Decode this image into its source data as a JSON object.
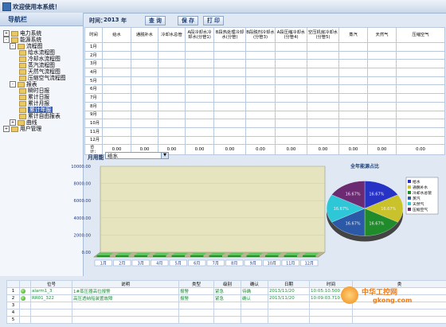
{
  "window": {
    "title": "欢迎使用本系统！"
  },
  "nav": {
    "header": "导航栏",
    "items": [
      {
        "label": "电力系统"
      },
      {
        "label": "能源系统"
      },
      {
        "label": "流程图"
      },
      {
        "label": "给水流程图"
      },
      {
        "label": "冷却水流程图"
      },
      {
        "label": "蒸汽流程图"
      },
      {
        "label": "天然气流程图"
      },
      {
        "label": "压缩空气流程图"
      },
      {
        "label": "报表"
      },
      {
        "label": "瞬时日报"
      },
      {
        "label": "累计日报"
      },
      {
        "label": "累计月报"
      },
      {
        "label": "累计年报"
      },
      {
        "label": "累计自由报表"
      },
      {
        "label": "曲线"
      },
      {
        "label": "用户管理"
      }
    ]
  },
  "toolbar": {
    "time_label": "时间：",
    "year": "2013",
    "year_unit": "年",
    "query": "查 询",
    "save": "保 存",
    "print": "打 印"
  },
  "table": {
    "headers": [
      "时间",
      "给水",
      "通脱补水",
      "冷却水总管",
      "A段冷却水冷却水(分管1)",
      "B段热处理冷却水(分管)",
      "B段脱剂冷却水(分管3)",
      "A段压缩冷却水(分管4)",
      "空压机房冷却水(分管5)",
      "蒸汽",
      "天然气",
      "压缩空气"
    ],
    "months": [
      "1月",
      "2月",
      "3月",
      "4月",
      "5月",
      "6月",
      "7月",
      "8月",
      "9月",
      "10月",
      "11月",
      "12月"
    ],
    "total_label": "合计：",
    "totals": [
      "0.00",
      "0.00",
      "0.00",
      "0.00",
      "0.00",
      "0.00",
      "0.00",
      "0.00",
      "0.00",
      "0.00",
      "0.00"
    ]
  },
  "selector": {
    "label": "月用能",
    "value": "给水"
  },
  "chart_data": [
    {
      "type": "bar",
      "categories": [
        "1月",
        "2月",
        "3月",
        "4月",
        "5月",
        "6月",
        "7月",
        "8月",
        "9月",
        "10月",
        "11月",
        "12月"
      ],
      "values": [
        0,
        0,
        0,
        0,
        0,
        0,
        0,
        0,
        0,
        0,
        0,
        0
      ],
      "yticks": [
        "10000.00",
        "8000.00",
        "6000.00",
        "4000.00",
        "2000.00",
        "0.00"
      ],
      "ylim": [
        0,
        10000
      ]
    },
    {
      "type": "pie",
      "title": "全年能源占比",
      "slices": [
        {
          "name": "给水",
          "value": 16.67,
          "color": "#2733c4"
        },
        {
          "name": "通脱补水",
          "value": 16.67,
          "color": "#c9c22a"
        },
        {
          "name": "冷却水总管",
          "value": 16.67,
          "color": "#1f8b2a"
        },
        {
          "name": "蒸汽",
          "value": 16.67,
          "color": "#2b59a8"
        },
        {
          "name": "天然气",
          "value": 16.67,
          "color": "#2ec7d8"
        },
        {
          "name": "压缩空气",
          "value": 16.67,
          "color": "#6b2a72"
        }
      ],
      "labels": [
        "16.67%",
        "16.67%",
        "16.67%",
        "16.67%",
        "16.67%",
        "16.67%"
      ]
    }
  ],
  "alarms": {
    "headers": [
      "",
      "",
      "位号",
      "说明",
      "类型",
      "级别",
      "确认",
      "日期",
      "时间",
      "类"
    ],
    "rows": [
      {
        "no": "1",
        "tag": "alarm1_3",
        "desc": "1#蒸压器高位报警",
        "type": "报警",
        "level": "紧急",
        "ack": "待确",
        "date": "2013/11/20",
        "time": "10:05:10.500"
      },
      {
        "no": "2",
        "tag": "RR01_322",
        "desc": "高压透纳船装置故障",
        "type": "报警",
        "level": "紧急",
        "ack": "确认",
        "date": "2013/11/20",
        "time": "10:09:03.710"
      },
      {
        "no": "3"
      },
      {
        "no": "4"
      },
      {
        "no": "5"
      }
    ]
  },
  "watermark": {
    "cn": "中华工控网",
    "url": "gkong.com"
  },
  "colors": {
    "titlebar": "#c9d7ea",
    "chart_bg": "#e6e4bf",
    "accent": "#1a3f7a"
  }
}
